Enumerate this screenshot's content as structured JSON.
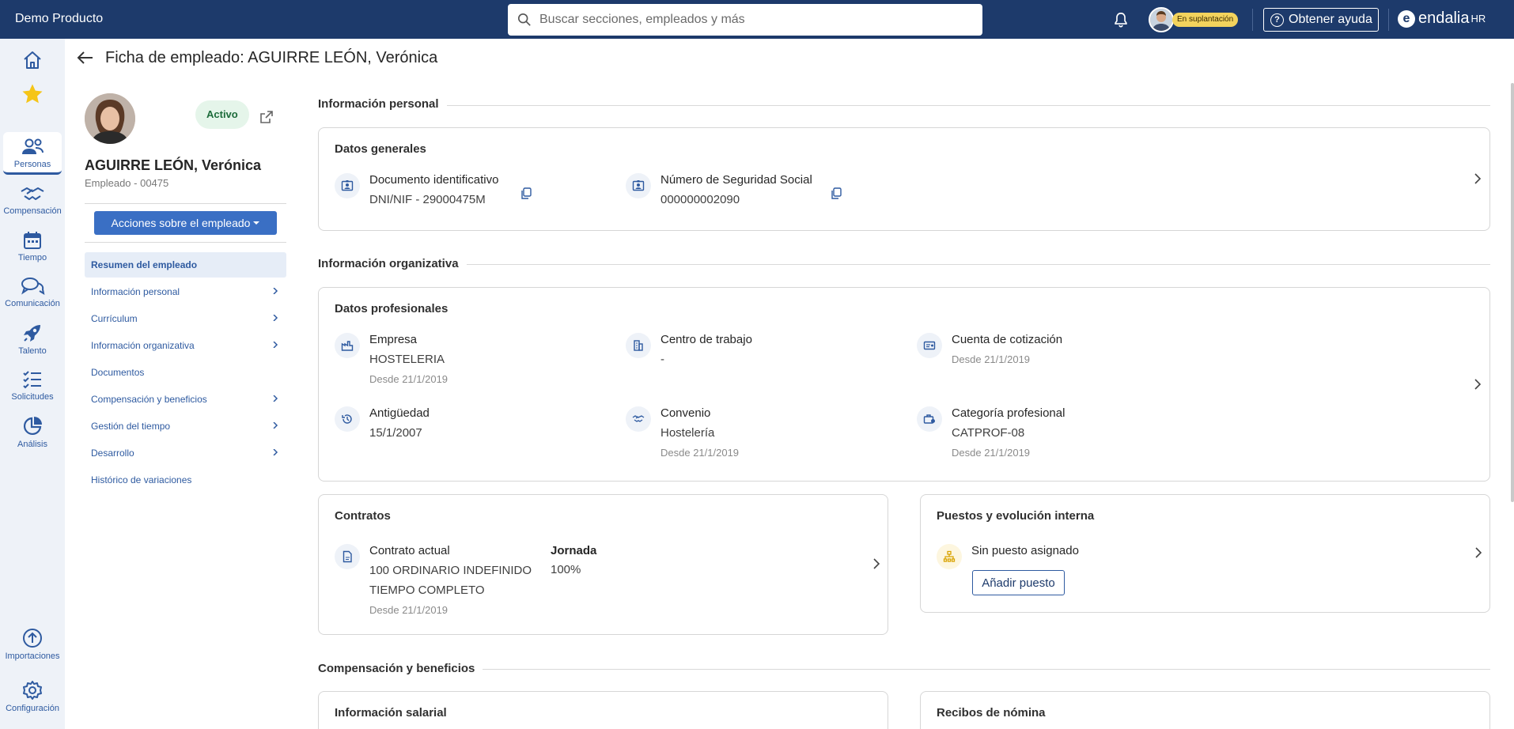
{
  "app": {
    "title": "Demo Producto"
  },
  "search": {
    "placeholder": "Buscar secciones, empleados y más"
  },
  "topbar": {
    "impersonation_badge": "En suplantación",
    "help_label": "Obtener ayuda",
    "logo_text": "endalia",
    "logo_suffix": "HR"
  },
  "rail": {
    "items": [
      {
        "label": "",
        "icon": "home-icon"
      },
      {
        "label": "",
        "icon": "star-icon"
      },
      {
        "label": "Personas",
        "icon": "people-icon"
      },
      {
        "label": "Compensación",
        "icon": "handshake-icon"
      },
      {
        "label": "Tiempo",
        "icon": "calendar-icon"
      },
      {
        "label": "Comunicación",
        "icon": "chat-icon"
      },
      {
        "label": "Talento",
        "icon": "rocket-icon"
      },
      {
        "label": "Solicitudes",
        "icon": "checklist-icon"
      },
      {
        "label": "Análisis",
        "icon": "pie-chart-icon"
      },
      {
        "label": "Importaciones",
        "icon": "upload-icon"
      },
      {
        "label": "Configuración",
        "icon": "gear-icon"
      }
    ]
  },
  "page": {
    "title": "Ficha de empleado: AGUIRRE LEÓN, Verónica"
  },
  "employee": {
    "status": "Activo",
    "name": "AGUIRRE LEÓN, Verónica",
    "code": "Empleado - 00475",
    "actions_label": "Acciones sobre el empleado"
  },
  "nav": {
    "items": [
      {
        "label": "Resumen del empleado",
        "selected": true,
        "chevron": false
      },
      {
        "label": "Información personal",
        "chevron": true
      },
      {
        "label": "Currículum",
        "chevron": true
      },
      {
        "label": "Información organizativa",
        "chevron": true
      },
      {
        "label": "Documentos",
        "chevron": false
      },
      {
        "label": "Compensación y beneficios",
        "chevron": true
      },
      {
        "label": "Gestión del tiempo",
        "chevron": true
      },
      {
        "label": "Desarrollo",
        "chevron": true
      },
      {
        "label": "Histórico de variaciones",
        "chevron": false
      }
    ]
  },
  "sections": {
    "personal": {
      "title": "Información personal",
      "card_title": "Datos generales",
      "doc": {
        "label": "Documento identificativo",
        "value": "DNI/NIF - 29000475M"
      },
      "ssn": {
        "label": "Número de Seguridad Social",
        "value": "000000002090"
      }
    },
    "org": {
      "title": "Información organizativa",
      "card_title": "Datos profesionales",
      "empresa": {
        "label": "Empresa",
        "value": "HOSTELERIA",
        "since": "Desde 21/1/2019"
      },
      "centro": {
        "label": "Centro de trabajo",
        "value": "-"
      },
      "cuenta": {
        "label": "Cuenta de cotización",
        "since": "Desde 21/1/2019"
      },
      "antiguedad": {
        "label": "Antigüedad",
        "value": "15/1/2007"
      },
      "convenio": {
        "label": "Convenio",
        "value": "Hostelería",
        "since": "Desde 21/1/2019"
      },
      "categoria": {
        "label": "Categoría profesional",
        "value": "CATPROF-08",
        "since": "Desde 21/1/2019"
      }
    },
    "contratos": {
      "card_title": "Contratos",
      "actual_label": "Contrato actual",
      "actual_line1": "100 ORDINARIO INDEFINIDO",
      "actual_line2": "TIEMPO COMPLETO",
      "actual_since": "Desde 21/1/2019",
      "jornada_label": "Jornada",
      "jornada_value": "100%"
    },
    "puestos": {
      "card_title": "Puestos y evolución interna",
      "empty_label": "Sin puesto asignado",
      "add_label": "Añadir puesto"
    },
    "comp": {
      "title": "Compensación y beneficios",
      "salary_card_title": "Información salarial",
      "payslips_card_title": "Recibos de nómina"
    }
  },
  "colors": {
    "topbar": "#1d3a6b",
    "accent": "#2e5aa0",
    "button": "#3a6fc4",
    "status_bg": "#e5f5ea"
  }
}
